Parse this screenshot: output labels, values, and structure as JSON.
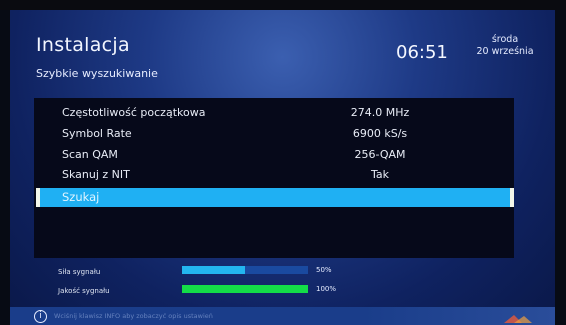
{
  "header": {
    "title": "Instalacja",
    "subtitle": "Szybkie wyszukiwanie",
    "time": "06:51",
    "day": "środa",
    "date": "20 września"
  },
  "settings": [
    {
      "label": "Częstotliwość początkowa",
      "value": "274.0 MHz"
    },
    {
      "label": "Symbol Rate",
      "value": "6900 kS/s"
    },
    {
      "label": "Scan QAM",
      "value": "256-QAM"
    },
    {
      "label": "Skanuj z NIT",
      "value": "Tak"
    }
  ],
  "search_button": {
    "label": "Szukaj"
  },
  "signal": {
    "strength_label": "Siła sygnału",
    "strength_percent": 50,
    "strength_text": "50%",
    "quality_label": "Jakość sygnału",
    "quality_percent": 100,
    "quality_text": "100%"
  },
  "colors": {
    "selection": "#1fb0f3",
    "strength_bar": "#23b6ef",
    "quality_bar": "#14dd48"
  },
  "icons": {
    "info": "info-icon"
  },
  "footer": {
    "info_glyph": "i",
    "hint": "Wciśnij klawisz INFO aby zobaczyć opis ustawień"
  }
}
